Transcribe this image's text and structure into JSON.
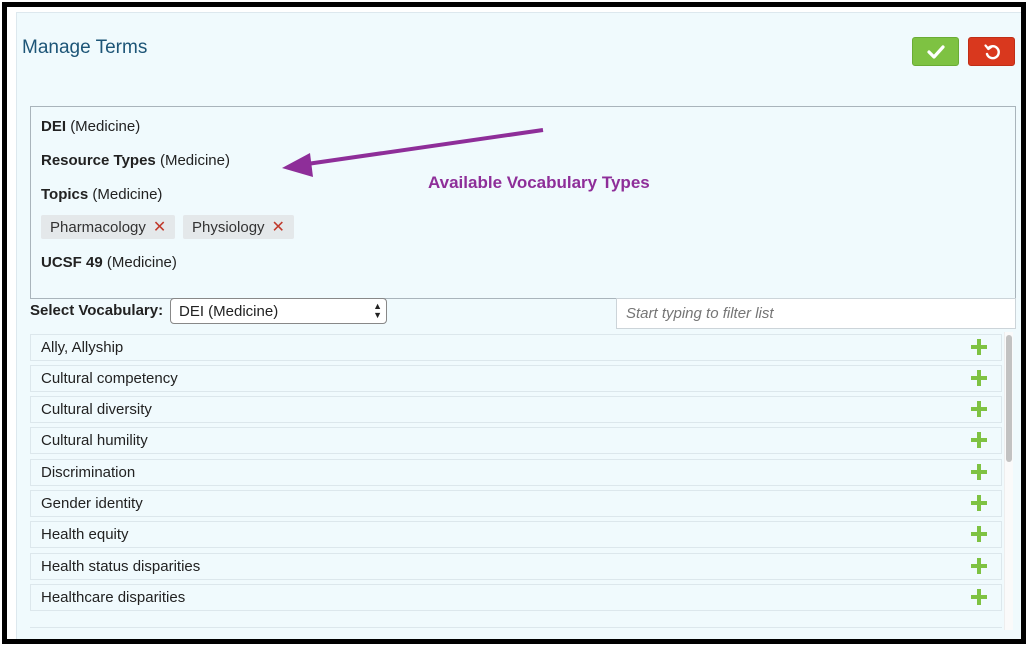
{
  "header": {
    "title": "Manage Terms",
    "save_icon": "check-icon",
    "reset_icon": "undo-icon",
    "save_color": "#7ec242",
    "reset_color": "#d9381e"
  },
  "vocabularies": [
    {
      "name": "DEI",
      "school": "(Medicine)"
    },
    {
      "name": "Resource Types",
      "school": "(Medicine)"
    },
    {
      "name": "Topics",
      "school": "(Medicine)"
    },
    {
      "name": "UCSF 49",
      "school": "(Medicine)"
    }
  ],
  "selected_terms": [
    {
      "label": "Pharmacology",
      "remove_icon": "x-icon"
    },
    {
      "label": "Physiology",
      "remove_icon": "x-icon"
    }
  ],
  "annotation": {
    "text": "Available Vocabulary Types",
    "color": "#8e2e99"
  },
  "select": {
    "label": "Select Vocabulary:",
    "value": "DEI (Medicine)"
  },
  "filter": {
    "placeholder": "Start typing to filter list"
  },
  "terms": [
    {
      "label": "Ally, Allyship"
    },
    {
      "label": "Cultural competency"
    },
    {
      "label": "Cultural diversity"
    },
    {
      "label": "Cultural humility"
    },
    {
      "label": "Discrimination"
    },
    {
      "label": "Gender identity"
    },
    {
      "label": "Health equity"
    },
    {
      "label": "Health status disparities"
    },
    {
      "label": "Healthcare disparities"
    }
  ]
}
